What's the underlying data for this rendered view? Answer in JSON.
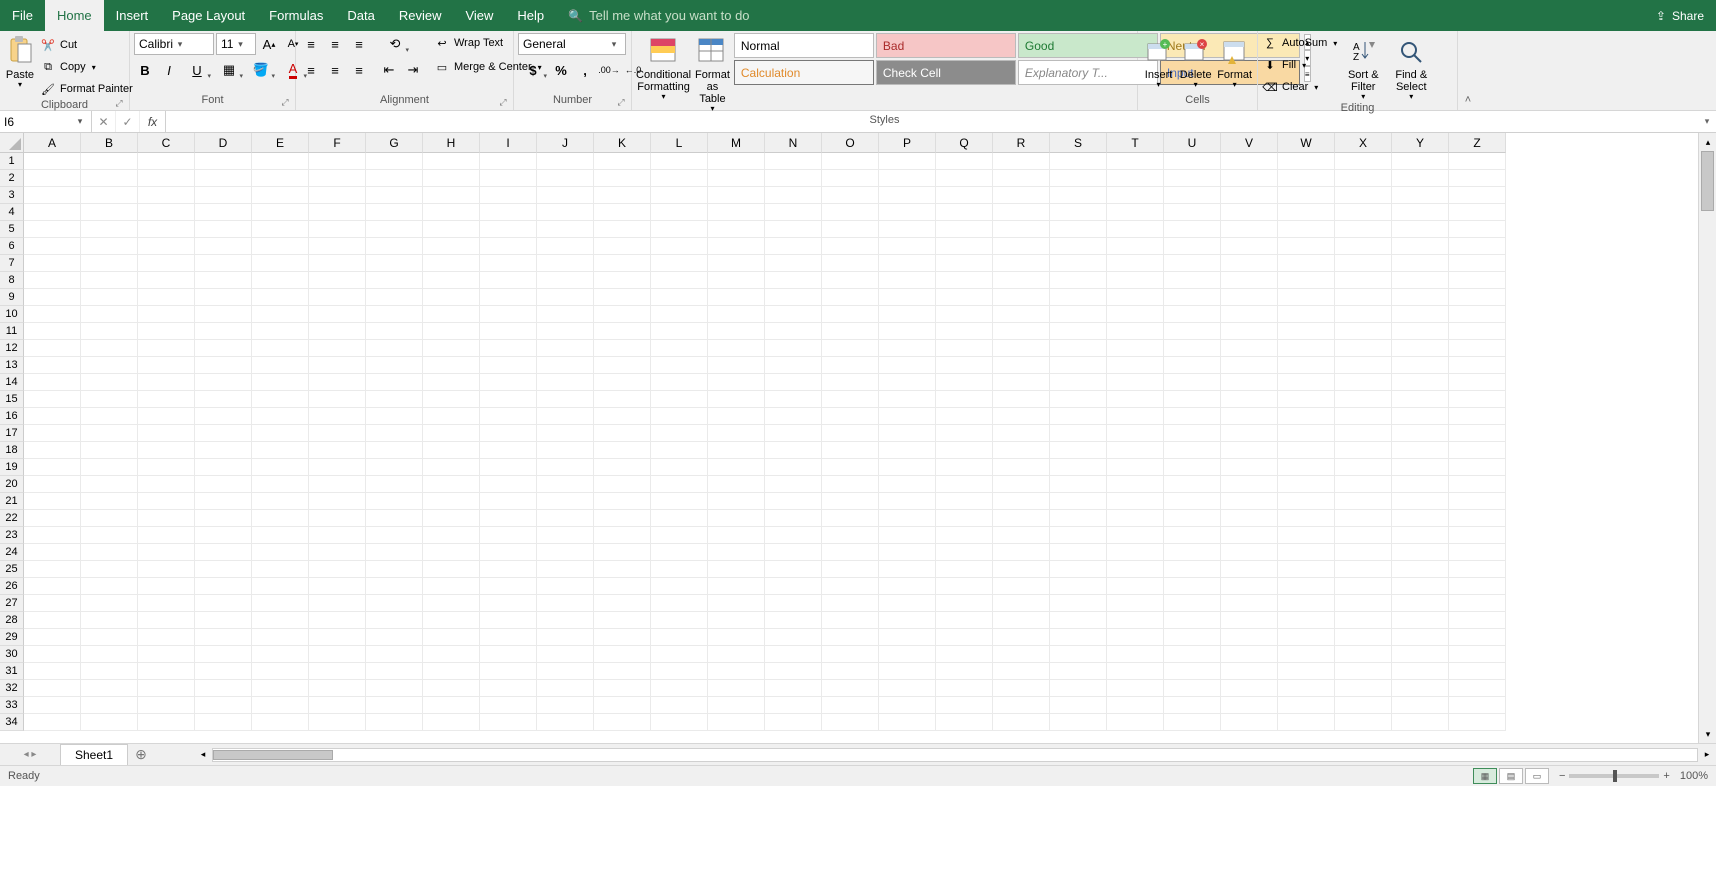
{
  "tabs": [
    "File",
    "Home",
    "Insert",
    "Page Layout",
    "Formulas",
    "Data",
    "Review",
    "View",
    "Help"
  ],
  "active_tab": "Home",
  "tell_me_placeholder": "Tell me what you want to do",
  "share_label": "Share",
  "clipboard": {
    "paste": "Paste",
    "cut": "Cut",
    "copy": "Copy",
    "format_painter": "Format Painter",
    "group": "Clipboard"
  },
  "font": {
    "name": "Calibri",
    "size": "11",
    "group": "Font"
  },
  "alignment": {
    "wrap": "Wrap Text",
    "merge": "Merge & Center",
    "group": "Alignment"
  },
  "number": {
    "format": "General",
    "group": "Number"
  },
  "styles": {
    "conditional": "Conditional Formatting",
    "format_as_table": "Format as Table",
    "gallery": [
      {
        "label": "Normal",
        "bg": "#ffffff",
        "fg": "#000"
      },
      {
        "label": "Bad",
        "bg": "#f6c6c6",
        "fg": "#aa2b2b"
      },
      {
        "label": "Good",
        "bg": "#c9e8cb",
        "fg": "#1e7a33"
      },
      {
        "label": "Neutral",
        "bg": "#fbe9b6",
        "fg": "#a07a1c"
      },
      {
        "label": "Calculation",
        "bg": "#f6f6f6",
        "fg": "#e08a2b",
        "border": "#777"
      },
      {
        "label": "Check Cell",
        "bg": "#8c8c8c",
        "fg": "#ffffff"
      },
      {
        "label": "Explanatory T...",
        "bg": "#ffffff",
        "fg": "#888",
        "italic": true
      },
      {
        "label": "Input",
        "bg": "#f9d9a3",
        "fg": "#4c6fbf",
        "border": "#777"
      }
    ],
    "group": "Styles"
  },
  "cells": {
    "insert": "Insert",
    "delete": "Delete",
    "format": "Format",
    "group": "Cells"
  },
  "editing": {
    "autosum": "AutoSum",
    "fill": "Fill",
    "clear": "Clear",
    "sort_filter": "Sort & Filter",
    "find_select": "Find & Select",
    "group": "Editing"
  },
  "name_box": "I6",
  "formula": "",
  "columns": [
    "A",
    "B",
    "C",
    "D",
    "E",
    "F",
    "G",
    "H",
    "I",
    "J",
    "K",
    "L",
    "M",
    "N",
    "O",
    "P",
    "Q",
    "R",
    "S",
    "T",
    "U",
    "V",
    "W",
    "X",
    "Y",
    "Z"
  ],
  "rows": 34,
  "sheet_tabs": [
    "Sheet1"
  ],
  "status": "Ready",
  "zoom": "100%"
}
